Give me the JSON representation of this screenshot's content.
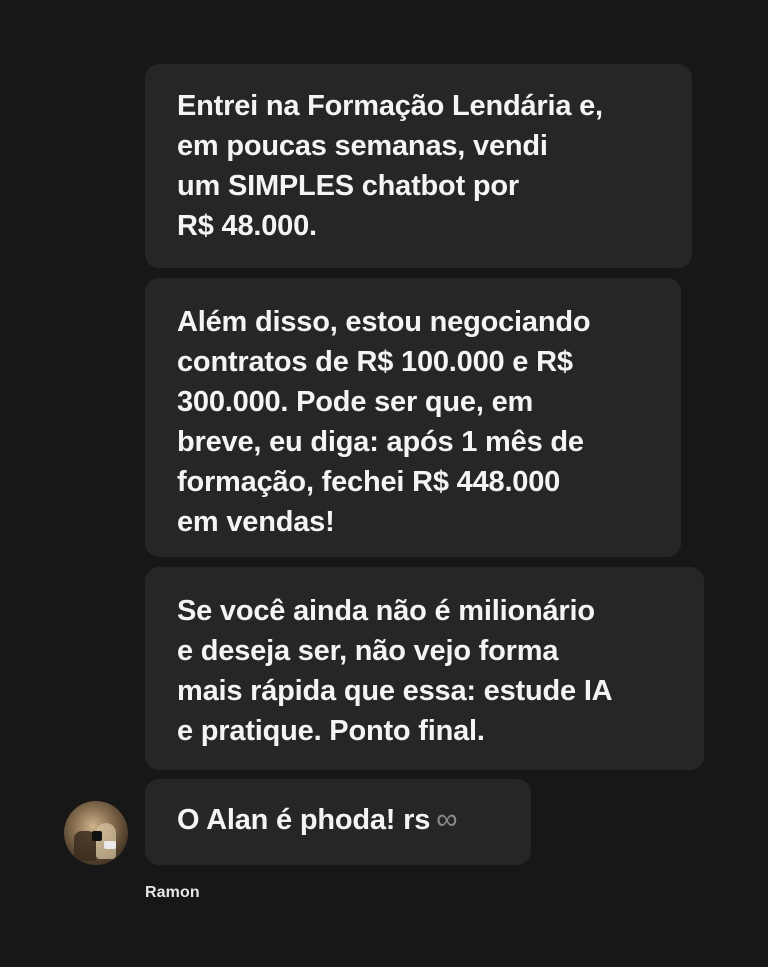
{
  "messages": [
    {
      "text": "Entrei na Formação Lendária e,\nem poucas semanas, vendi\num SIMPLES chatbot por\nR$ 48.000."
    },
    {
      "text": "Além disso, estou negociando\ncontratos de R$ 100.000 e R$\n300.000. Pode ser que, em\nbreve, eu diga: após 1 mês de\nformação, fechei R$ 448.000\nem vendas!"
    },
    {
      "text": "Se você ainda não é milionário\ne deseja ser, não vejo forma\nmais rápida que essa: estude IA\ne pratique. Ponto final."
    },
    {
      "text": "O Alan é phoda! rs",
      "trailing_icon": "infinity-icon",
      "trailing_glyph": "∞"
    }
  ],
  "sender": {
    "name": "Ramon",
    "avatar_icon": "user-avatar"
  },
  "colors": {
    "background": "#171717",
    "bubble": "#262626",
    "text": "#f4f4f4",
    "muted_icon": "#8a8a8a"
  }
}
